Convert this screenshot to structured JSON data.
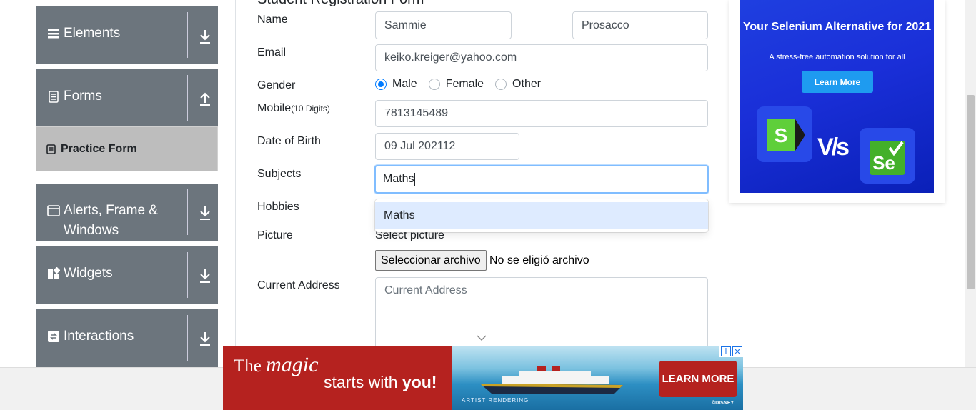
{
  "sidebar": {
    "groups": [
      {
        "label": "Elements",
        "icon": "menu-icon",
        "arrow": "download-arrow-icon"
      },
      {
        "label": "Forms",
        "icon": "document-icon",
        "arrow": "upload-arrow-icon"
      },
      {
        "label": "Alerts, Frame & Windows",
        "icon": "window-icon",
        "arrow": "download-arrow-icon"
      },
      {
        "label": "Widgets",
        "icon": "widgets-icon",
        "arrow": "download-arrow-icon"
      },
      {
        "label": "Interactions",
        "icon": "interactions-icon",
        "arrow": "download-arrow-icon"
      }
    ],
    "active_item": {
      "label": "Practice Form",
      "icon": "form-icon"
    }
  },
  "form": {
    "title": "Student Registration Form",
    "name_label": "Name",
    "first_name": "Sammie",
    "last_name": "Prosacco",
    "email_label": "Email",
    "email": "keiko.kreiger@yahoo.com",
    "gender_label": "Gender",
    "gender_options": [
      "Male",
      "Female",
      "Other"
    ],
    "gender_selected": "Male",
    "mobile_label": "Mobile",
    "mobile_hint": "(10 Digits)",
    "mobile": "7813145489",
    "dob_label": "Date of Birth",
    "dob": "09 Jul 202112",
    "subjects_label": "Subjects",
    "subjects_value": "Maths",
    "subjects_suggestion": "Maths",
    "hobbies_label": "Hobbies",
    "picture_label": "Picture",
    "select_picture": "Select picture",
    "file_button": "Seleccionar archivo",
    "file_status": "No se eligió archivo",
    "address_label": "Current Address",
    "address_placeholder": "Current Address"
  },
  "ad_right": {
    "headline": "Your Selenium Alternative for 2021",
    "subline": "A stress-free automation solution for all",
    "button": "Learn More",
    "vs": "V/s"
  },
  "ad_bottom": {
    "line1_a": "The ",
    "line1_b": "magic",
    "line2_a": "starts with ",
    "line2_b": "you!",
    "button": "LEARN MORE",
    "artist": "ARTIST RENDERING",
    "brand": "©DISNEY"
  },
  "colors": {
    "sidebar_header": "#6c757d",
    "sidebar_active": "#bdbdbd",
    "focus_border": "#80bdff",
    "radio_checked": "#007bff",
    "ad_red": "#b5221f",
    "ad_blue": "#1a2fd8"
  }
}
